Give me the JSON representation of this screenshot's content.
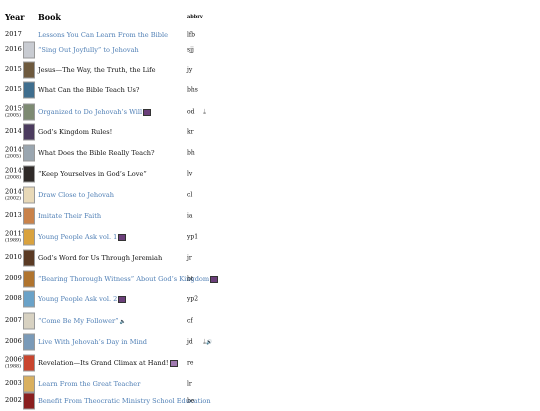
{
  "headers": {
    "year": "Year",
    "book": "Book",
    "abbrev": "abbrv"
  },
  "rows": [
    {
      "year": "2017",
      "sub": "",
      "title": "Lessons You Can Learn From the Bible",
      "link": true,
      "abbr": "lfb",
      "color": "",
      "mark": "",
      "speaker": false,
      "download": false
    },
    {
      "year": "2016",
      "sub": "",
      "title": "“Sing Out Joyfully” to Jehovah",
      "link": true,
      "abbr": "sjj",
      "color": "#c9ccd2",
      "mark": "",
      "speaker": false,
      "download": false
    },
    {
      "year": "2015",
      "sub": "",
      "title": "Jesus—The Way, the Truth, the Life",
      "link": false,
      "abbr": "jy",
      "color": "#6e5a3e",
      "mark": "",
      "speaker": false,
      "download": false
    },
    {
      "year": "2015",
      "sub": "",
      "title": "What Can the Bible Teach Us?",
      "link": false,
      "abbr": "bhs",
      "color": "#3f6e8e",
      "mark": "",
      "speaker": false,
      "download": false
    },
    {
      "year": "2015*",
      "sub": "(2005)",
      "title": "Organized to Do Jehovah’s Will",
      "link": true,
      "abbr": "od",
      "color": "#7d8a72",
      "mark": "purple",
      "speaker": false,
      "download": true
    },
    {
      "year": "2014",
      "sub": "",
      "title": "God’s Kingdom Rules!",
      "link": false,
      "abbr": "kr",
      "color": "#4b3b5e",
      "mark": "",
      "speaker": false,
      "download": false
    },
    {
      "year": "2014*",
      "sub": "(2005)",
      "title": "What Does the Bible Really Teach?",
      "link": false,
      "abbr": "bh",
      "color": "#9aa6b0",
      "mark": "",
      "speaker": false,
      "download": false
    },
    {
      "year": "2014*",
      "sub": "(2008)",
      "title": "“Keep Yourselves in God’s Love”",
      "link": false,
      "abbr": "lv",
      "color": "#2f2a28",
      "mark": "",
      "speaker": false,
      "download": false
    },
    {
      "year": "2014*",
      "sub": "(2002)",
      "title": "Draw Close to Jehovah",
      "link": true,
      "abbr": "cl",
      "color": "#e8d9b8",
      "mark": "",
      "speaker": false,
      "download": false
    },
    {
      "year": "2013",
      "sub": "",
      "title": "Imitate Their Faith",
      "link": true,
      "abbr": "ia",
      "color": "#c9824a",
      "mark": "",
      "speaker": false,
      "download": false
    },
    {
      "year": "2011*",
      "sub": "(1989)",
      "title": "Young People Ask vol. 1",
      "link": true,
      "abbr": "yp1",
      "color": "#d9a23e",
      "mark": "purple",
      "speaker": false,
      "download": false
    },
    {
      "year": "2010",
      "sub": "",
      "title": "God’s Word for Us Through Jeremiah",
      "link": false,
      "abbr": "jr",
      "color": "#5a3a24",
      "mark": "",
      "speaker": false,
      "download": false
    },
    {
      "year": "2009",
      "sub": "",
      "title": "“Bearing Thorough Witness” About God’s Kingdom",
      "link": true,
      "abbr": "bt",
      "color": "#b0742e",
      "mark": "purple",
      "speaker": false,
      "download": false
    },
    {
      "year": "2008",
      "sub": "",
      "title": "Young People Ask vol. 2",
      "link": true,
      "abbr": "yp2",
      "color": "#6aa2c8",
      "mark": "purple",
      "speaker": false,
      "download": false
    },
    {
      "year": "2007",
      "sub": "",
      "title": "“Come Be My Follower”",
      "link": true,
      "abbr": "cf",
      "color": "#d8d2c2",
      "mark": "",
      "speaker": true,
      "download": false
    },
    {
      "year": "2006",
      "sub": "",
      "title": "Live With Jehovah’s Day in Mind",
      "link": true,
      "abbr": "jd",
      "color": "#7a9ab8",
      "mark": "",
      "speaker": false,
      "download": true,
      "speaker2": true
    },
    {
      "year": "2006*",
      "sub": "(1988)",
      "title": "Revelation—Its Grand Climax at Hand!",
      "link": false,
      "abbr": "re",
      "color": "#c9452e",
      "mark": "light",
      "speaker": false,
      "download": false
    },
    {
      "year": "2003",
      "sub": "",
      "title": "Learn From the Great Teacher",
      "link": true,
      "abbr": "lr",
      "color": "#d9b060",
      "mark": "",
      "speaker": false,
      "download": false
    },
    {
      "year": "2002",
      "sub": "",
      "title": "Benefit From Theocratic Ministry School Education",
      "link": true,
      "abbr": "be",
      "color": "#8a1f1f",
      "mark": "",
      "speaker": false,
      "download": false
    }
  ],
  "icons": {
    "download": "download-icon",
    "speaker": "speaker-icon",
    "format_badge": "format-badge-icon"
  },
  "colors": {
    "link": "#4f7fb5",
    "text": "#111111"
  }
}
